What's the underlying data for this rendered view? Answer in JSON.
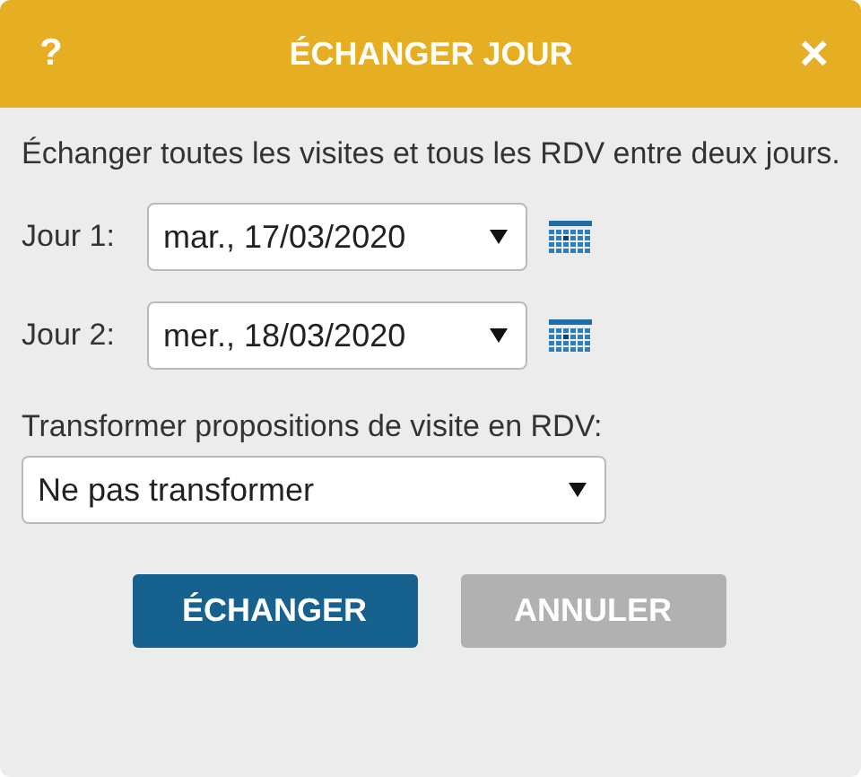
{
  "dialog": {
    "help_button": "?",
    "title": "ÉCHANGER JOUR",
    "close_button": "×"
  },
  "description": "Échanger toutes les visites et tous les RDV entre deux jours.",
  "date_fields": [
    {
      "label": "Jour 1:",
      "value": "mar., 17/03/2020"
    },
    {
      "label": "Jour 2:",
      "value": "mer., 18/03/2020"
    }
  ],
  "conversion": {
    "label": "Transformer propositions de visite en RDV:",
    "value": "Ne pas transformer"
  },
  "buttons": [
    {
      "label": "ÉCHANGER",
      "kind": "primary"
    },
    {
      "label": "ANNULER",
      "kind": "secondary"
    }
  ]
}
